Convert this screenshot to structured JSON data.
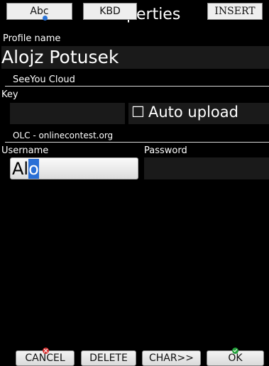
{
  "title": "Profile properties",
  "title_visible_part": "roperties",
  "keyboard_bar": {
    "abc_label": "Abc",
    "kbd_label": "KBD",
    "insert_label": "INSERT"
  },
  "profile": {
    "name_label": "Profile name",
    "name_value": "Alojz Potusek"
  },
  "seeyou": {
    "section_title": "SeeYou Cloud",
    "key_label": "Key",
    "key_value": "",
    "auto_upload_label": "Auto upload",
    "auto_upload_checked": false,
    "checkbox_glyph": "☐"
  },
  "olc": {
    "section_title": "OLC - onlinecontest.org",
    "username_label": "Username",
    "username_before_cursor": "Al",
    "username_selected": "o",
    "password_label": "Password",
    "password_value": ""
  },
  "buttons": {
    "cancel": "CANCEL",
    "delete": "DELETE",
    "char": "CHAR>>",
    "ok": "OK"
  },
  "colors": {
    "background": "#000000",
    "selection": "#2a6fd6",
    "cancel_icon": "#d83030",
    "ok_icon": "#22a13a"
  }
}
